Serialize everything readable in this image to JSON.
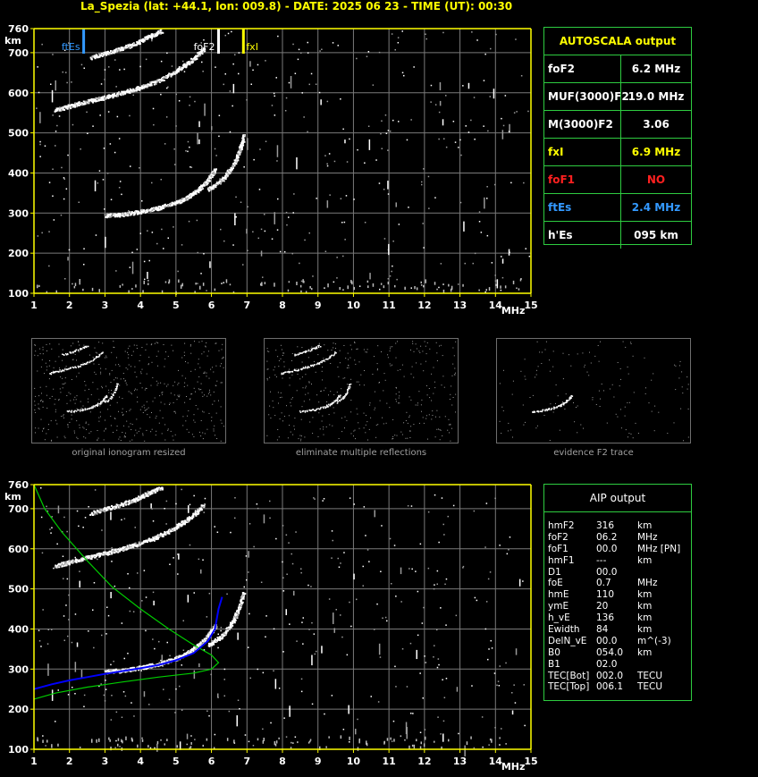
{
  "header": {
    "title": "La_Spezia (lat: +44.1, lon: 009.8) - DATE: 2025 06 23 - TIME (UT): 00:30"
  },
  "colors": {
    "axis": "#ffff00",
    "grid": "#7a7a7a",
    "panel_border": "#2ecc40",
    "ftEs": "#3399ff",
    "fxI": "#ffff00",
    "foF1": "#ff2020",
    "profile": "#00cc00",
    "trace_fit": "#0000ff"
  },
  "autoscala": {
    "title": "AUTOSCALA output",
    "rows": [
      {
        "label": "foF2",
        "value": "6.2 MHz",
        "color": "#ffffff"
      },
      {
        "label": "MUF(3000)F2",
        "value": "19.0 MHz",
        "color": "#ffffff"
      },
      {
        "label": "M(3000)F2",
        "value": "3.06",
        "color": "#ffffff"
      },
      {
        "label": "fxI",
        "value": "6.9 MHz",
        "color": "#ffff00"
      },
      {
        "label": "foF1",
        "value": "NO",
        "color": "#ff2020"
      },
      {
        "label": "ftEs",
        "value": "2.4 MHz",
        "color": "#3399ff"
      },
      {
        "label": "h'Es",
        "value": "095     km",
        "color": "#ffffff"
      }
    ]
  },
  "aip": {
    "title": "AIP output",
    "rows": [
      {
        "name": "hmF2",
        "value": "316",
        "unit": "km"
      },
      {
        "name": "foF2",
        "value": "06.2",
        "unit": "MHz"
      },
      {
        "name": "foF1",
        "value": "00.0",
        "unit": "MHz   [PN]"
      },
      {
        "name": "hmF1",
        "value": "---",
        "unit": "km"
      },
      {
        "name": "D1",
        "value": "00.0",
        "unit": ""
      },
      {
        "name": "foE",
        "value": "0.7",
        "unit": "MHz"
      },
      {
        "name": "hmE",
        "value": "110",
        "unit": "km"
      },
      {
        "name": "ymE",
        "value": "20",
        "unit": "km"
      },
      {
        "name": "h_vE",
        "value": "136",
        "unit": "km"
      },
      {
        "name": "Ewidth",
        "value": "84",
        "unit": "km"
      },
      {
        "name": "DelN_vE",
        "value": "00.0",
        "unit": "m^(-3)"
      },
      {
        "name": "B0",
        "value": "054.0",
        "unit": "km"
      },
      {
        "name": "B1",
        "value": "02.0",
        "unit": ""
      },
      {
        "name": "TEC[Bot]",
        "value": "002.0",
        "unit": "TECU"
      },
      {
        "name": "TEC[Top]",
        "value": "006.1",
        "unit": "TECU"
      }
    ]
  },
  "thumbnails": [
    {
      "caption": "original ionogram resized"
    },
    {
      "caption": "eliminate multiple reflections"
    },
    {
      "caption": "evidence F2 trace"
    }
  ],
  "chart_data": [
    {
      "type": "scatter",
      "title": "",
      "xlabel": "MHz",
      "ylabel": "km",
      "xlim": [
        1,
        15
      ],
      "ylim": [
        100,
        760
      ],
      "xticks": [
        "1",
        "2",
        "3",
        "4",
        "5",
        "6",
        "7",
        "8",
        "9",
        "10",
        "11",
        "12",
        "13",
        "14",
        "15"
      ],
      "yticks": [
        "100",
        "200",
        "300",
        "400",
        "500",
        "600",
        "700",
        "760"
      ],
      "grid": true,
      "markers": [
        {
          "label": "ftEs",
          "x": 2.4,
          "color": "#3399ff"
        },
        {
          "label": "foF2",
          "x": 6.2,
          "color": "#ffffff"
        },
        {
          "label": "fxI",
          "x": 6.9,
          "color": "#ffff00"
        }
      ],
      "traces": [
        {
          "name": "O-mode F2 trace",
          "points": [
            [
              3.0,
              295
            ],
            [
              3.5,
              298
            ],
            [
              4.0,
              305
            ],
            [
              4.5,
              314
            ],
            [
              5.0,
              328
            ],
            [
              5.3,
              340
            ],
            [
              5.6,
              358
            ],
            [
              5.9,
              385
            ],
            [
              6.1,
              410
            ]
          ]
        },
        {
          "name": "X-mode F2 trace",
          "points": [
            [
              5.9,
              360
            ],
            [
              6.3,
              385
            ],
            [
              6.6,
              420
            ],
            [
              6.8,
              460
            ],
            [
              6.9,
              495
            ]
          ]
        },
        {
          "name": "second-hop O trace",
          "points": [
            [
              1.6,
              558
            ],
            [
              2.0,
              568
            ],
            [
              2.5,
              580
            ],
            [
              3.0,
              590
            ],
            [
              3.5,
              602
            ],
            [
              4.0,
              615
            ],
            [
              4.5,
              632
            ],
            [
              5.0,
              655
            ],
            [
              5.4,
              680
            ],
            [
              5.8,
              712
            ]
          ]
        },
        {
          "name": "second-hop X trace",
          "points": [
            [
              2.6,
              690
            ],
            [
              3.2,
              705
            ],
            [
              3.8,
              722
            ],
            [
              4.2,
              740
            ],
            [
              4.6,
              755
            ]
          ]
        }
      ]
    },
    {
      "type": "line",
      "title": "",
      "xlabel": "MHz",
      "ylabel": "km",
      "xlim": [
        1,
        15
      ],
      "ylim": [
        100,
        760
      ],
      "xticks": [
        "1",
        "2",
        "3",
        "4",
        "5",
        "6",
        "7",
        "8",
        "9",
        "10",
        "11",
        "12",
        "13",
        "14",
        "15"
      ],
      "yticks": [
        "100",
        "200",
        "300",
        "400",
        "500",
        "600",
        "700",
        "760"
      ],
      "grid": true,
      "series": [
        {
          "name": "",
          "points": [
            [
              1.0,
              760
            ],
            [
              1.3,
              700
            ],
            [
              1.8,
              640
            ],
            [
              2.5,
              570
            ],
            [
              3.2,
              505
            ],
            [
              4.0,
              450
            ],
            [
              4.8,
              400
            ],
            [
              5.5,
              360
            ],
            [
              6.0,
              335
            ],
            [
              6.2,
              316
            ],
            [
              6.0,
              300
            ],
            [
              5.5,
              290
            ],
            [
              4.5,
              280
            ],
            [
              3.5,
              268
            ],
            [
              2.5,
              255
            ],
            [
              1.6,
              240
            ],
            [
              1.0,
              225
            ]
          ]
        },
        {
          "name": "",
          "points": [
            [
              1.0,
              250
            ],
            [
              1.5,
              262
            ],
            [
              2.0,
              272
            ],
            [
              2.5,
              280
            ],
            [
              3.0,
              288
            ],
            [
              3.5,
              295
            ],
            [
              4.0,
              302
            ],
            [
              4.5,
              310
            ],
            [
              5.0,
              322
            ],
            [
              5.5,
              340
            ],
            [
              5.9,
              370
            ],
            [
              6.1,
              400
            ],
            [
              6.2,
              450
            ],
            [
              6.3,
              480
            ]
          ]
        }
      ]
    }
  ]
}
